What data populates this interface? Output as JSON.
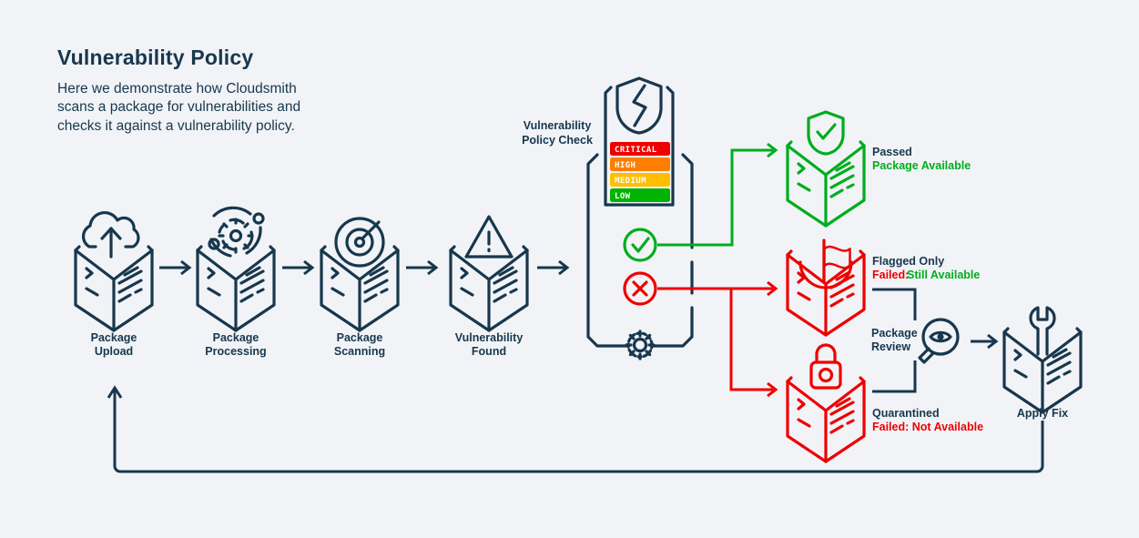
{
  "header": {
    "title": "Vulnerability Policy",
    "description_lines": [
      "Here we demonstrate how Cloudsmith",
      "scans a package for vulnerabilities and",
      "checks it against a vulnerability policy."
    ]
  },
  "colors": {
    "background": "#f1f3f7",
    "navy": "#17374d",
    "green": "#00ad1e",
    "red": "#ee0000",
    "critical": "#ee0000",
    "high": "#fc7f00",
    "medium": "#ffbf00",
    "low": "#00b300"
  },
  "pipeline": {
    "stages": [
      {
        "id": "package-upload",
        "icon": "cloud-upload-icon",
        "label_line1": "Package",
        "label_line2": "Upload"
      },
      {
        "id": "package-processing",
        "icon": "gear-orbit-icon",
        "label_line1": "Package",
        "label_line2": "Processing"
      },
      {
        "id": "package-scanning",
        "icon": "radar-scan-icon",
        "label_line1": "Package",
        "label_line2": "Scanning"
      },
      {
        "id": "vulnerability-found",
        "icon": "warning-triangle-icon",
        "label_line1": "Vulnerability",
        "label_line2": "Found"
      }
    ]
  },
  "policy_check": {
    "label_line1": "Vulnerability",
    "label_line2": "Policy Check",
    "icon": "cracked-shield-icon",
    "severities": [
      {
        "label": "CRITICAL",
        "color": "#ee0000"
      },
      {
        "label": "HIGH",
        "color": "#fc7f00"
      },
      {
        "label": "MEDIUM",
        "color": "#ffbf00"
      },
      {
        "label": "LOW",
        "color": "#00b300"
      }
    ],
    "decisions": [
      {
        "id": "pass-decision",
        "icon": "check-circle-icon",
        "color": "#00ad1e"
      },
      {
        "id": "fail-decision",
        "icon": "x-circle-icon",
        "color": "#ee0000"
      }
    ],
    "config_icon": "gear-icon"
  },
  "outcomes": [
    {
      "id": "passed",
      "icon": "shield-check-package-icon",
      "color": "#00ad1e",
      "title": "Passed",
      "status": "Package Available",
      "status_color": "#00ad1e"
    },
    {
      "id": "flagged-only",
      "icon": "flag-package-icon",
      "color": "#ee0000",
      "title": "Flagged Only",
      "status_prefix": "Failed:",
      "status_prefix_color": "#ee0000",
      "status_suffix": "Still Available",
      "status_suffix_color": "#00ad1e"
    },
    {
      "id": "quarantined",
      "icon": "lock-package-icon",
      "color": "#ee0000",
      "title": "Quarantined",
      "status": "Failed: Not Available",
      "status_color": "#ee0000"
    }
  ],
  "review": {
    "label_line1": "Package",
    "label_line2": "Review",
    "icon": "eye-magnifier-icon"
  },
  "apply_fix": {
    "label": "Apply Fix",
    "icon": "wrench-package-icon"
  }
}
